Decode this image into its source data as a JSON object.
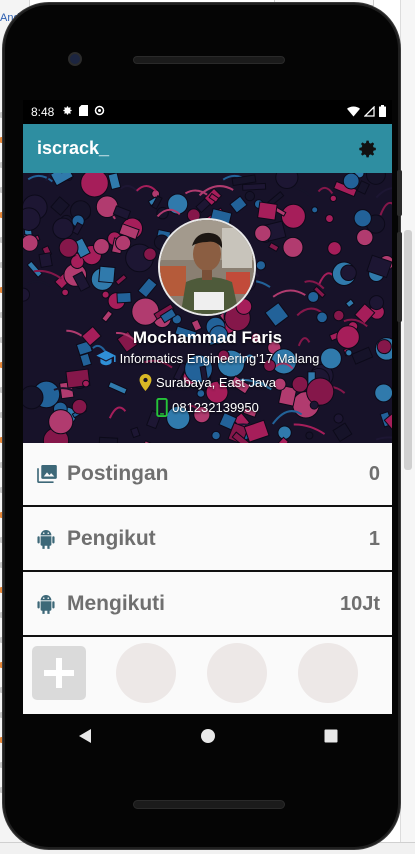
{
  "background_window": {
    "tab_text": "And"
  },
  "status_bar": {
    "time": "8:48",
    "icons": [
      "gear-icon",
      "sd-card-icon",
      "sync-icon"
    ],
    "right_icons": [
      "wifi-icon",
      "signal-icon",
      "battery-icon"
    ]
  },
  "app_bar": {
    "title": "iscrack_",
    "settings_icon": "gear-icon"
  },
  "profile": {
    "name": "Mochammad Faris",
    "education": "Informatics Engineering'17 Malang",
    "location": "Surabaya, East Java",
    "phone": "081232139950"
  },
  "stats": [
    {
      "icon": "image-icon",
      "label": "Postingan",
      "value": "0"
    },
    {
      "icon": "android-icon",
      "label": "Pengikut",
      "value": "1"
    },
    {
      "icon": "android-icon",
      "label": "Mengikuti",
      "value": "10Jt"
    }
  ],
  "action_bar": {
    "add_icon": "plus-icon",
    "slots": 3
  },
  "nav_bar": {
    "icons": [
      "back-icon",
      "home-icon",
      "recents-icon"
    ]
  },
  "colors": {
    "app_bar": "#2e8ea1",
    "stat_text": "#6f6f6f",
    "slot_circle": "#ede8e7",
    "add_button": "#dadada",
    "grad_icon": "#2f8fd6",
    "pin_icon": "#d9b825",
    "phone_icon": "#26c43a"
  }
}
